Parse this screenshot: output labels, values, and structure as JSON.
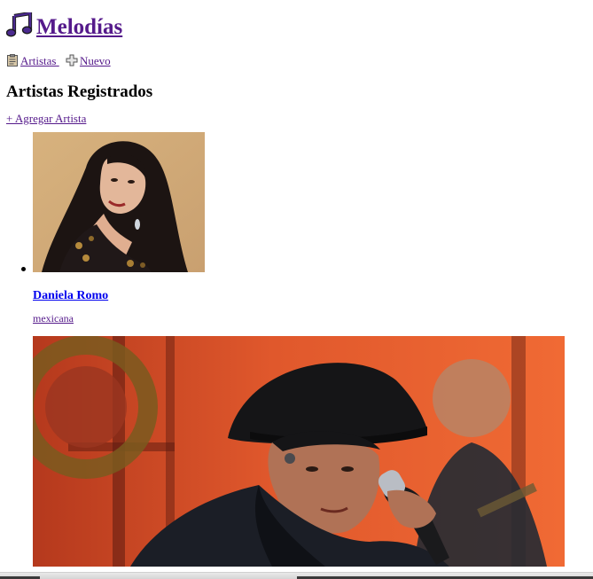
{
  "site": {
    "title": "Melodías",
    "title_icon": "music-note-icon"
  },
  "nav": {
    "items": [
      {
        "label": "Artistas",
        "icon": "clipboard-icon"
      },
      {
        "label": "Nuevo",
        "icon": "plus-icon"
      }
    ]
  },
  "main": {
    "heading": "Artistas Registrados",
    "add_label": "+ Agregar Artista",
    "artists": [
      {
        "name": "Daniela Romo",
        "nationality": "mexicana"
      },
      {
        "name": "",
        "nationality": ""
      }
    ]
  },
  "colors": {
    "visited_link": "#551a8b",
    "link": "#0000ee",
    "icon_purple": "#4b2a8f"
  }
}
